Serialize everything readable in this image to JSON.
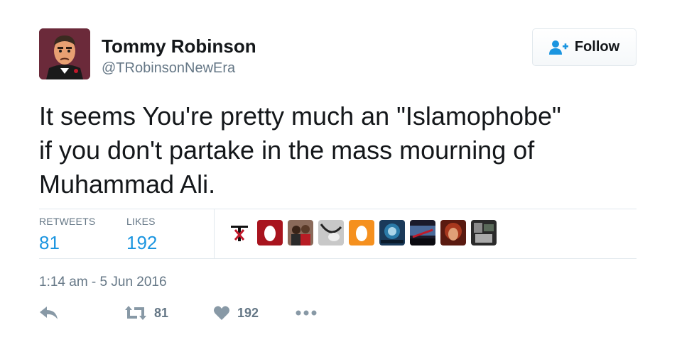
{
  "user": {
    "name": "Tommy Robinson",
    "handle": "@TRobinsonNewEra"
  },
  "follow_button": {
    "label": "Follow"
  },
  "tweet": {
    "text": "It seems You're pretty much an \"Islamophobe\"\nif you don't partake in the mass mourning of\nMuhammad Ali."
  },
  "stats": {
    "retweets_label": "RETWEETS",
    "retweets_value": "81",
    "likes_label": "LIKES",
    "likes_value": "192"
  },
  "timestamp": "1:14 am - 5 Jun 2016",
  "actions": {
    "retweet_count": "81",
    "like_count": "192"
  },
  "colors": {
    "accent": "#1b95e0",
    "muted": "#657786",
    "border": "#e1e8ed"
  },
  "icons": [
    "avatar-cartoon",
    "follow-user-plus-icon",
    "reply-icon",
    "retweet-icon",
    "heart-icon",
    "more-icon"
  ]
}
